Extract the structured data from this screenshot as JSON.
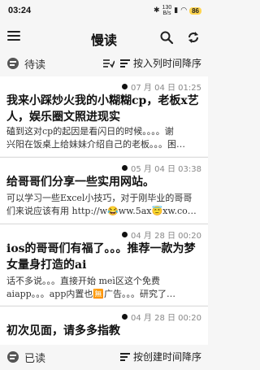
{
  "status": {
    "time": "03:24",
    "net_speed_top": "130",
    "net_speed_bottom": "B/s",
    "battery": "86"
  },
  "app": {
    "title": "慢读"
  },
  "unread_section": {
    "title": "待读",
    "sort_label": "按入列时间降序"
  },
  "articles": [
    {
      "date": "07 月 04 日 01:25",
      "title": "我来小踩炒火我的小糊糊cp，老板x艺人，娱乐圈文照进现实",
      "excerpt_lines": [
        "磕到这对cp的起因是看闪日的时候。。。。谢",
        "兴阳在饭桌上给妹妹介绍自己的老板。。。困…"
      ]
    },
    {
      "date": "05 月 04 日 03:38",
      "title": "给哥哥们分享一些实用网站。",
      "excerpt_lines": [
        "可以学习一些Excel小技巧，对于刚毕业的哥哥",
        "们来说应该有用 http://w😂ww.5ax😇xw.co…"
      ]
    },
    {
      "date": "04 月 28 日 00:20",
      "title": "ios的哥哥们有福了。。。推荐一款为梦女量身打造的ai",
      "excerpt_lines": [
        "话不多说。。。直接开始 meì区这个免费",
        "aiapp。。。app内置也🈚广告。。。研究了…"
      ]
    },
    {
      "date": "04 月 28 日 00:20",
      "title": "初次见面，请多多指教",
      "excerpt_lines": []
    }
  ],
  "read_section": {
    "title": "已读",
    "sort_label": "按创建时间降序"
  },
  "icons": {
    "menu": "menu-icon",
    "search": "search-icon",
    "sync": "sync-icon",
    "filter": "filter-icon",
    "sort": "sort-icon"
  }
}
